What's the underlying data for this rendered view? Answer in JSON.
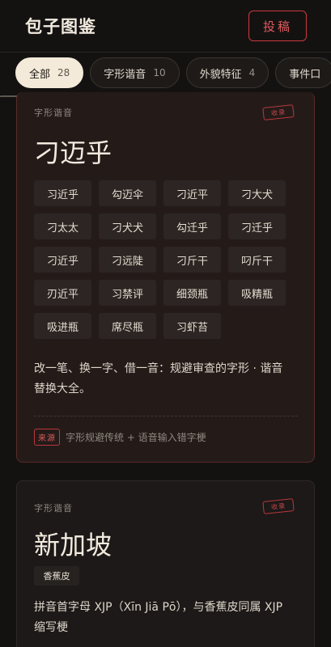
{
  "header": {
    "title": "包子图鉴",
    "submit_label": "投稿"
  },
  "tabs": [
    {
      "label": "全部",
      "count": "28",
      "active": true
    },
    {
      "label": "字形谐音",
      "count": "10",
      "active": false
    },
    {
      "label": "外貌特征",
      "count": "4",
      "active": false
    },
    {
      "label": "事件口",
      "count": "",
      "active": false
    }
  ],
  "cards": [
    {
      "category": "字形谐音",
      "stamp": "收录",
      "title": "刁迈乎",
      "variants": [
        "习近乎",
        "勾迈伞",
        "刁近平",
        "刁大犬",
        "刁太太",
        "刁犬犬",
        "勾迁乎",
        "刁迁乎",
        "刁近乎",
        "刁远陡",
        "刁斤干",
        "叼斤干",
        "刃近平",
        "习禁评",
        "细颈瓶",
        "吸精瓶",
        "吸进瓶",
        "席尽瓶",
        "习虾苔"
      ],
      "description": "改一笔、换一字、借一音：规避审查的字形 · 谐音替换大全。",
      "source_badge": "来源",
      "source_text": "字形规避传统 + 语音输入错字梗"
    },
    {
      "category": "字形谐音",
      "stamp": "收录",
      "title": "新加坡",
      "variants": [
        "香蕉皮"
      ],
      "description": "拼音首字母 XJP（Xīn Jiā Pō），与香蕉皮同属 XJP 缩写梗"
    }
  ],
  "colors": {
    "accent": "#c9393f",
    "background": "#141211",
    "active_tab": "#f3ead9"
  }
}
